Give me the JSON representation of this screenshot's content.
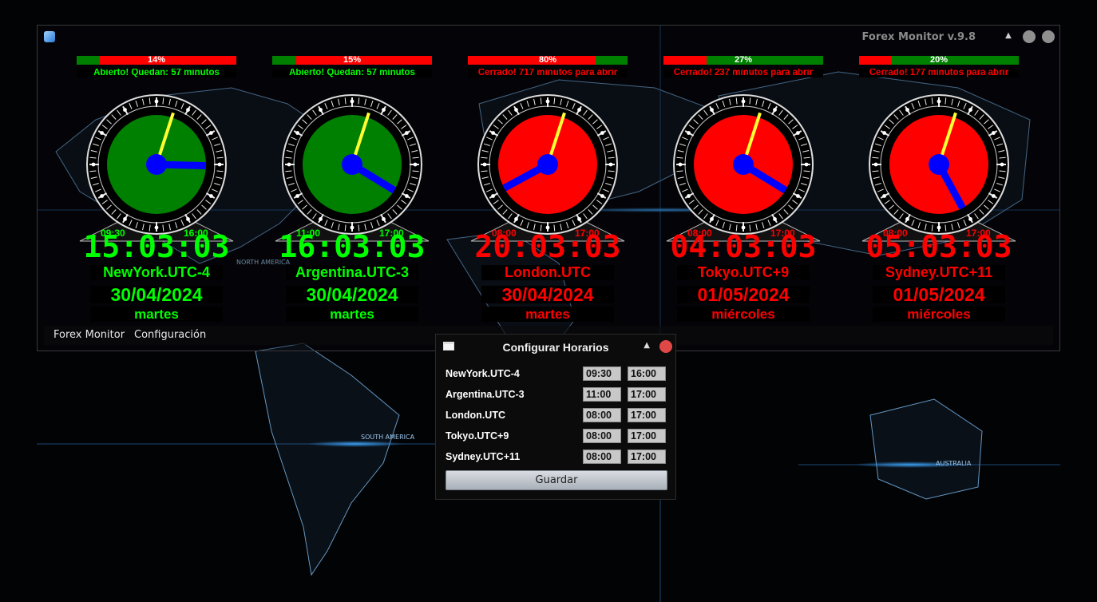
{
  "window": {
    "title": "Forex Monitor v.9.8",
    "minimize_icon": "arrow-up-icon"
  },
  "colors": {
    "open": "#00ff00",
    "closed": "#ff0000",
    "bar_green": "#008000",
    "bar_red": "#ff0000",
    "hand_minute": "#ffff33",
    "hand_hour": "#0000ff"
  },
  "markets": [
    {
      "percent": "14%",
      "fill": 0.14,
      "state": "open",
      "status": "Abierto! Quedan: 57 minutos",
      "open": "09:30",
      "close": "16:00",
      "time": "15:03:03",
      "tz": "NewYork.UTC-4",
      "date": "30/04/2024",
      "day": "martes"
    },
    {
      "percent": "15%",
      "fill": 0.15,
      "state": "open",
      "status": "Abierto! Quedan: 57 minutos",
      "open": "11:00",
      "close": "17:00",
      "time": "16:03:03",
      "tz": "Argentina.UTC-3",
      "date": "30/04/2024",
      "day": "martes"
    },
    {
      "percent": "80%",
      "fill": 0.8,
      "state": "closed",
      "status": "Cerrado! 717 minutos para abrir",
      "open": "08:00",
      "close": "17:00",
      "time": "20:03:03",
      "tz": "London.UTC",
      "date": "30/04/2024",
      "day": "martes"
    },
    {
      "percent": "27%",
      "fill": 0.27,
      "state": "closed",
      "status": "Cerrado! 237 minutos para abrir",
      "open": "08:00",
      "close": "17:00",
      "time": "04:03:03",
      "tz": "Tokyo.UTC+9",
      "date": "01/05/2024",
      "day": "miércoles"
    },
    {
      "percent": "20%",
      "fill": 0.2,
      "state": "closed",
      "status": "Cerrado! 177 minutos para abrir",
      "open": "08:00",
      "close": "17:00",
      "time": "05:03:03",
      "tz": "Sydney.UTC+11",
      "date": "01/05/2024",
      "day": "miércoles"
    }
  ],
  "menu": {
    "items": [
      "Forex Monitor",
      "Configuración"
    ]
  },
  "map_labels": [
    "NORTH AMERICA",
    "SOUTH AMERICA",
    "AUSTRALIA"
  ],
  "dialog": {
    "title": "Configurar Horarios",
    "save_label": "Guardar",
    "rows": [
      {
        "name": "NewYork.UTC-4",
        "open": "09:30",
        "close": "16:00"
      },
      {
        "name": "Argentina.UTC-3",
        "open": "11:00",
        "close": "17:00"
      },
      {
        "name": "London.UTC",
        "open": "08:00",
        "close": "17:00"
      },
      {
        "name": "Tokyo.UTC+9",
        "open": "08:00",
        "close": "17:00"
      },
      {
        "name": "Sydney.UTC+11",
        "open": "08:00",
        "close": "17:00"
      }
    ]
  }
}
